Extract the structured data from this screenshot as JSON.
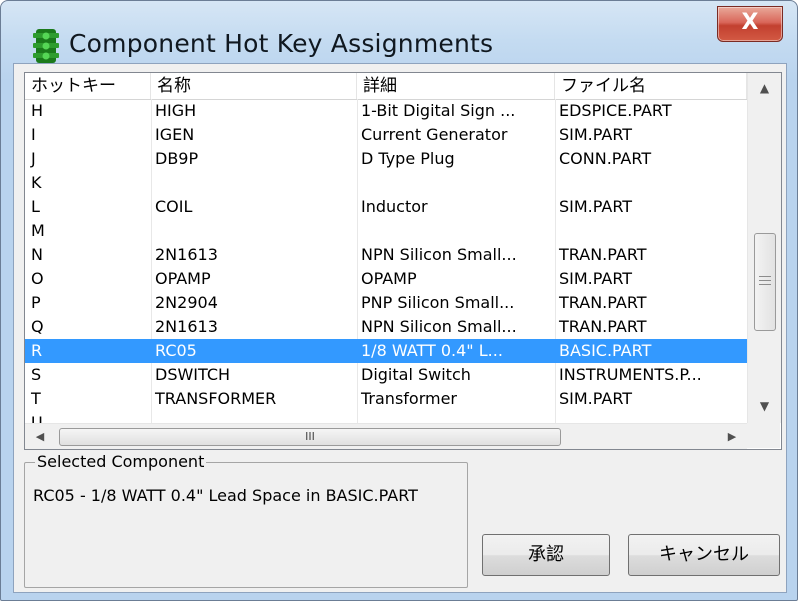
{
  "window": {
    "title": "Component Hot Key Assignments",
    "close_label": "X"
  },
  "list": {
    "columns": [
      "ホットキー",
      "名称",
      "詳細",
      "ファイル名"
    ],
    "rows": [
      [
        "H",
        "HIGH",
        "1-Bit Digital Sign ...",
        "EDSPICE.PART"
      ],
      [
        "I",
        "IGEN",
        "Current Generator",
        "SIM.PART"
      ],
      [
        "J",
        "DB9P",
        "D Type Plug",
        "CONN.PART"
      ],
      [
        "K",
        "",
        "",
        ""
      ],
      [
        "L",
        "COIL",
        "Inductor",
        "SIM.PART"
      ],
      [
        "M",
        "",
        "",
        ""
      ],
      [
        "N",
        "2N1613",
        "NPN Silicon Small...",
        "TRAN.PART"
      ],
      [
        "O",
        "OPAMP",
        "OPAMP",
        "SIM.PART"
      ],
      [
        "P",
        "2N2904",
        "PNP Silicon Small...",
        "TRAN.PART"
      ],
      [
        "Q",
        "2N1613",
        "NPN Silicon Small...",
        "TRAN.PART"
      ],
      [
        "R",
        "RC05",
        "1/8 WATT 0.4\" L...",
        "BASIC.PART"
      ],
      [
        "S",
        "DSWITCH",
        "Digital Switch",
        "INSTRUMENTS.P..."
      ],
      [
        "T",
        "TRANSFORMER",
        "Transformer",
        "SIM.PART"
      ],
      [
        "U",
        "",
        "",
        ""
      ]
    ],
    "selected_row": 10,
    "hscroll_label": "III"
  },
  "selected_component": {
    "legend": "Selected Component",
    "description": "RC05 - 1/8 WATT 0.4\" Lead Space in BASIC.PART"
  },
  "buttons": {
    "ok_label": "承認",
    "cancel_label": "キャンセル"
  },
  "colors": {
    "selection": "#3399ff",
    "close_button": "#c2402f"
  },
  "icons": {
    "app": "traffic-light-icon",
    "scroll_up": "scroll-up-arrow-icon",
    "scroll_down": "scroll-down-arrow-icon",
    "scroll_left": "scroll-left-arrow-icon",
    "scroll_right": "scroll-right-arrow-icon"
  }
}
